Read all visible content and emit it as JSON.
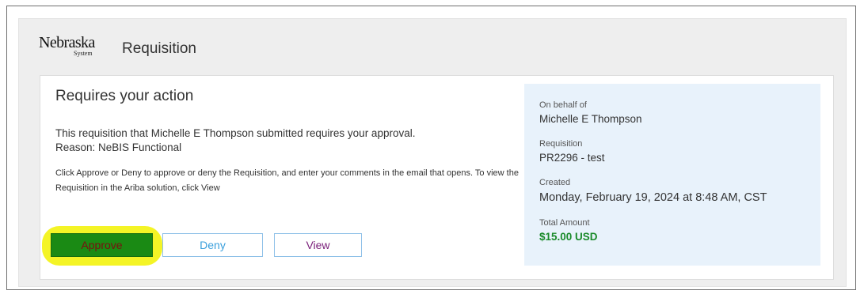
{
  "header": {
    "logo_text": "Nebraska",
    "logo_sub": "System",
    "title": "Requisition"
  },
  "card": {
    "title": "Requires your action",
    "approval_text": "This requisition that Michelle E Thompson submitted requires your approval.",
    "reason_text": "Reason: NeBIS Functional",
    "instructions": "Click Approve or Deny to approve or deny the Requisition, and enter your comments in the email that opens. To view the Requisition in the Ariba solution, click View",
    "buttons": {
      "approve": "Approve",
      "deny": "Deny",
      "view": "View"
    }
  },
  "summary": {
    "on_behalf_label": "On behalf of",
    "on_behalf_value": "Michelle E Thompson",
    "requisition_label": "Requisition",
    "requisition_value": "PR2296 - test",
    "created_label": "Created",
    "created_value": "Monday, February 19, 2024 at 8:48 AM, CST",
    "total_label": "Total Amount",
    "total_value": "$15.00 USD"
  },
  "colors": {
    "approve_bg": "#1a8a14",
    "approve_text": "#7a1010",
    "deny_text": "#3a9fdc",
    "view_text": "#7a1f7a",
    "summary_bg": "#e8f2fb",
    "amount_text": "#1a8a2a",
    "highlight": "#f2f200"
  }
}
